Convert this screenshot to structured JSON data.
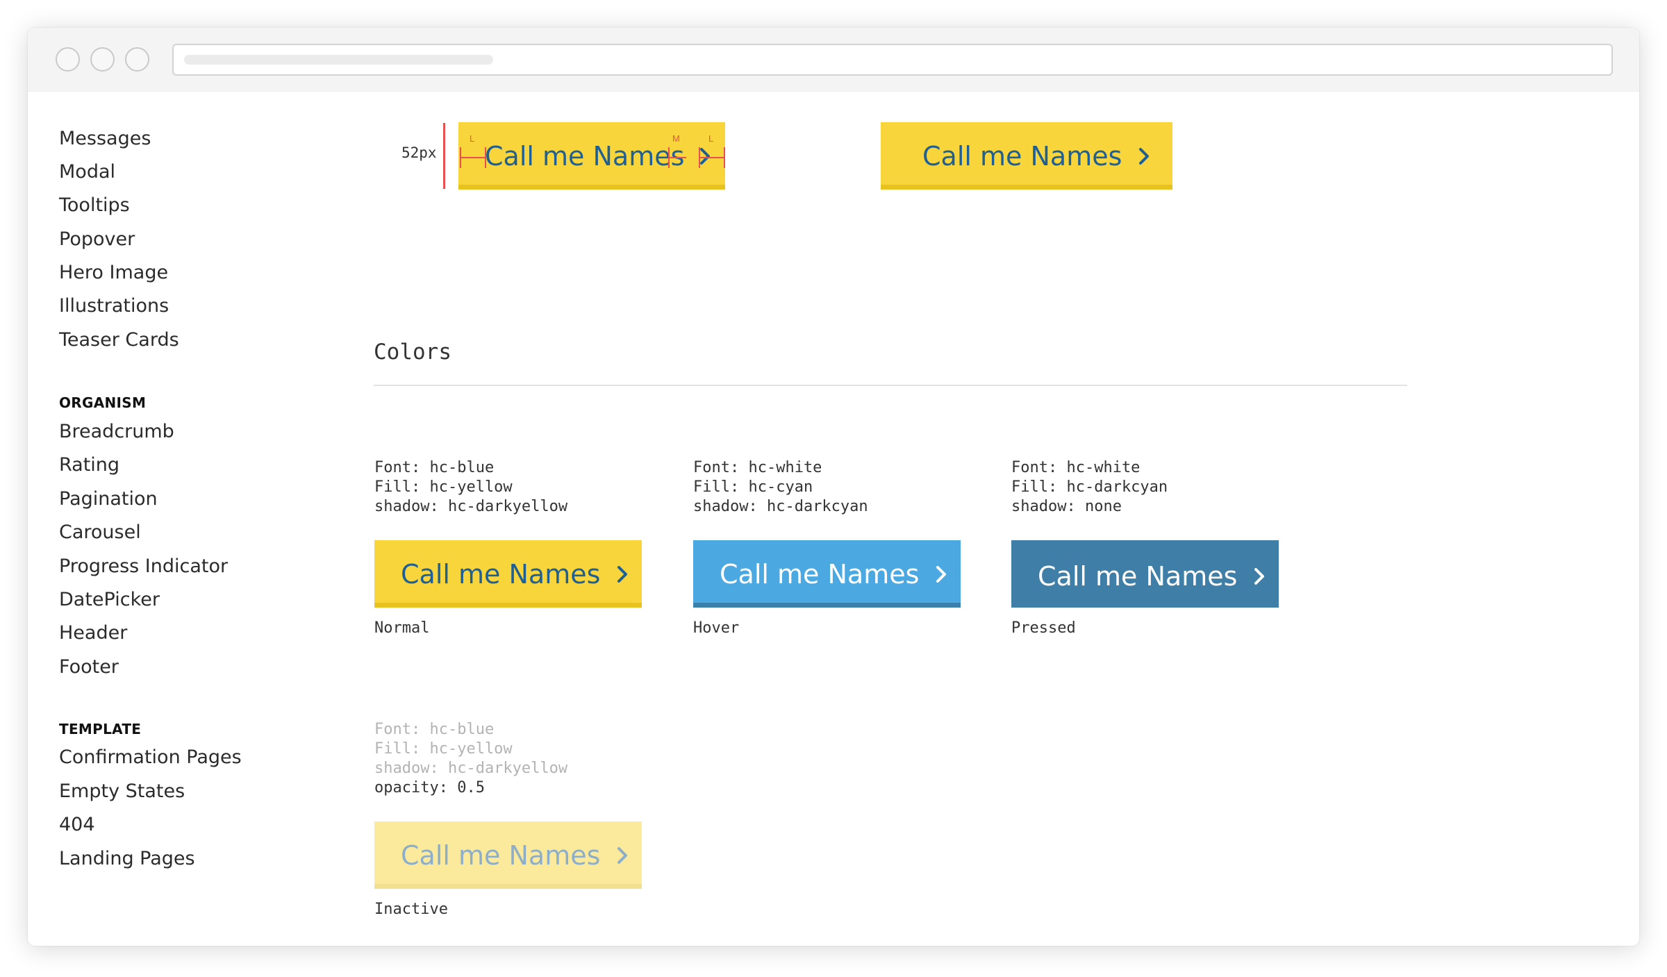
{
  "sidebar": {
    "items_top": [
      "Messages",
      "Modal",
      "Tooltips",
      "Popover",
      "Hero Image",
      "Illustrations",
      "Teaser Cards"
    ],
    "organism_heading": "ORGANISM",
    "items_organism": [
      "Breadcrumb",
      "Rating",
      "Pagination",
      "Carousel",
      "Progress Indicator",
      "DatePicker",
      "Header",
      "Footer"
    ],
    "template_heading": "TEMPLATE",
    "items_template": [
      "Confirmation Pages",
      "Empty States",
      "404",
      "Landing Pages"
    ]
  },
  "spacing_demo": {
    "height_label": "52px",
    "left_marker": "L",
    "middle_marker": "M",
    "right_marker": "L",
    "button_label": "Call me Names"
  },
  "preview_button": {
    "label": "Call me Names"
  },
  "colors_section": {
    "title": "Colors"
  },
  "states": [
    {
      "spec_font": "Font: hc-blue",
      "spec_fill": "Fill: hc-yellow",
      "spec_shadow": "shadow: hc-darkyellow",
      "label": "Call me Names",
      "caption": "Normal"
    },
    {
      "spec_font": "Font: hc-white",
      "spec_fill": "Fill: hc-cyan",
      "spec_shadow": "shadow: hc-darkcyan",
      "label": "Call me Names",
      "caption": "Hover"
    },
    {
      "spec_font": "Font: hc-white",
      "spec_fill": "Fill: hc-darkcyan",
      "spec_shadow": "shadow: none",
      "label": "Call me Names",
      "caption": "Pressed"
    }
  ],
  "inactive_state": {
    "spec_font": "Font: hc-blue",
    "spec_fill": "Fill: hc-yellow",
    "spec_shadow": "shadow: hc-darkyellow",
    "spec_opacity": "opacity: 0.5",
    "label": "Call me Names",
    "caption": "Inactive"
  },
  "colors": {
    "hc_yellow": "#f8d63b",
    "hc_darkyellow": "#e8c21f",
    "hc_blue": "#1e5f95",
    "hc_cyan": "#4ba8e0",
    "hc_darkcyan": "#3f7fa7",
    "measure_red": "#e8514f"
  },
  "icons": {
    "chevron": "chevron-right-icon"
  }
}
